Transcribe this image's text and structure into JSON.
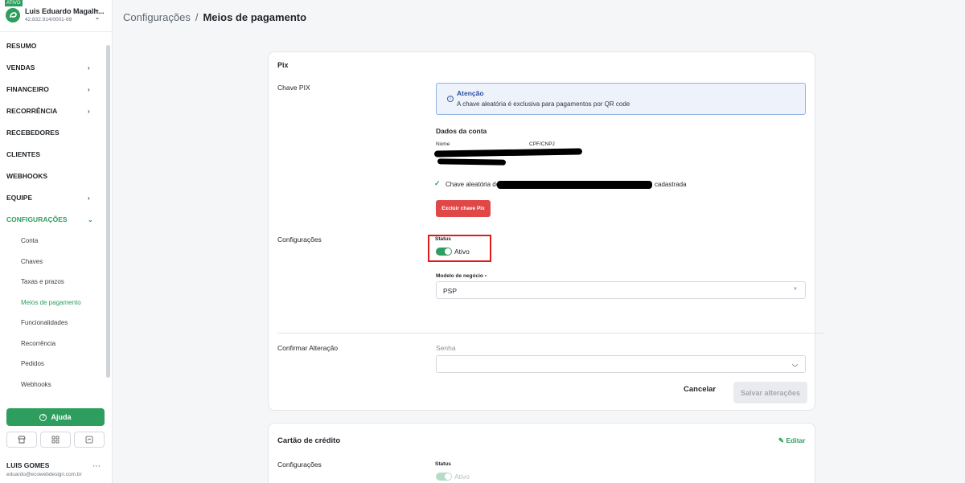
{
  "account": {
    "badge": "ATIVO",
    "name": "Luis Eduardo Magalh...",
    "document": "42.832.914/0001-69",
    "switch_icon": "chevron-up-down-icon"
  },
  "nav": {
    "items": [
      {
        "label": "RESUMO"
      },
      {
        "label": "VENDAS",
        "chevron": "›"
      },
      {
        "label": "FINANCEIRO",
        "chevron": "›"
      },
      {
        "label": "RECORRÊNCIA",
        "chevron": "›"
      },
      {
        "label": "RECEBEDORES"
      },
      {
        "label": "CLIENTES"
      },
      {
        "label": "WEBHOOKS"
      },
      {
        "label": "EQUIPE",
        "chevron": "›"
      },
      {
        "label": "CONFIGURAÇÕES",
        "chevron": "⌄"
      }
    ],
    "subitems": [
      {
        "label": "Conta"
      },
      {
        "label": "Chaves"
      },
      {
        "label": "Taxas e prazos"
      },
      {
        "label": "Meios de pagamento"
      },
      {
        "label": "Funcionalidades"
      },
      {
        "label": "Recorrência"
      },
      {
        "label": "Pedidos"
      },
      {
        "label": "Webhooks"
      }
    ]
  },
  "sidebar_footer": {
    "help_label": "Ajuda",
    "tools": [
      "store-icon",
      "grid-icon",
      "chart-icon"
    ],
    "user_name": "LUIS GOMES",
    "user_email": "eduardo@ecowebdesign.com.br",
    "more": "⋯"
  },
  "breadcrumb": {
    "parent": "Configurações",
    "separator": "/",
    "current": "Meios de pagamento"
  },
  "pix": {
    "title": "Pix",
    "chave_label": "Chave PIX",
    "alert": {
      "title": "Atenção",
      "text": "A chave aleatória é exclusiva para pagamentos por QR code"
    },
    "dados_title": "Dados da conta",
    "col_nome": "Nome",
    "col_cpf": "CPF/CNPJ",
    "chave_prefix": "Chave aleatória de",
    "chave_suffix": "cadastrada",
    "delete_button": "Excluir chave Pix",
    "config_label": "Configurações",
    "status_label": "Status",
    "status_value": "Ativo",
    "modelo_label": "Modelo de negócio",
    "modelo_required": "•",
    "modelo_value": "PSP",
    "confirm_label": "Confirmar Alteração",
    "senha_label": "Senha",
    "cancel_button": "Cancelar",
    "save_button": "Salvar alterações",
    "status_active": true
  },
  "credit_card": {
    "title": "Cartão de crédito",
    "edit_label": "Editar",
    "config_label": "Configurações",
    "status_label": "Status",
    "status_value": "Ativo"
  },
  "colors": {
    "accent": "#2e9e5e",
    "danger": "#e04848",
    "highlight_box": "#e01b1b"
  }
}
